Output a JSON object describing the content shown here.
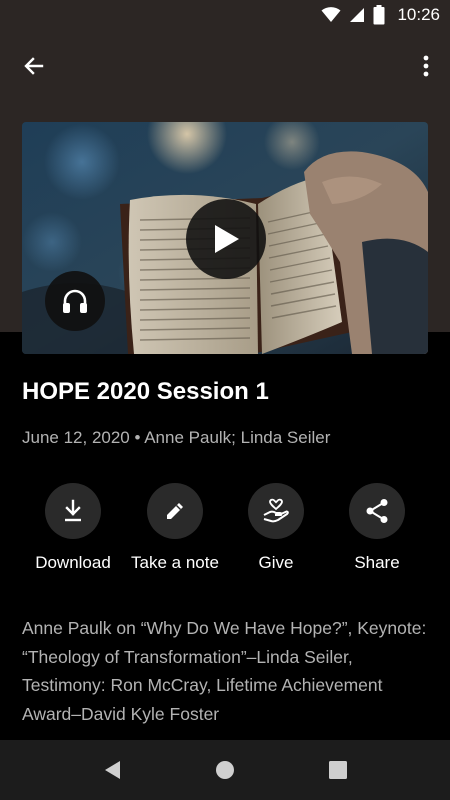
{
  "status_bar": {
    "time": "10:26"
  },
  "app_bar": {
    "back_icon": "arrow-left-icon",
    "menu_icon": "more-vert-icon"
  },
  "media": {
    "play_icon": "play-icon",
    "audio_icon": "headphones-icon"
  },
  "session": {
    "title": "HOPE 2020 Session 1",
    "meta": "June 12, 2020 • Anne Paulk; Linda Seiler",
    "description": "Anne Paulk on “Why Do We Have Hope?”, Keynote: “Theology of Transformation”–Linda Seiler, Testimony: Ron McCray, Lifetime Achievement Award–David Kyle Foster"
  },
  "actions": [
    {
      "label": "Download",
      "icon": "download-icon"
    },
    {
      "label": "Take a note",
      "icon": "pencil-icon"
    },
    {
      "label": "Give",
      "icon": "give-heart-hand-icon"
    },
    {
      "label": "Share",
      "icon": "share-icon"
    }
  ],
  "colors": {
    "hero_background": "#2c2624",
    "action_circle": "#2a2a2a",
    "secondary_text": "#b3b3b3"
  }
}
